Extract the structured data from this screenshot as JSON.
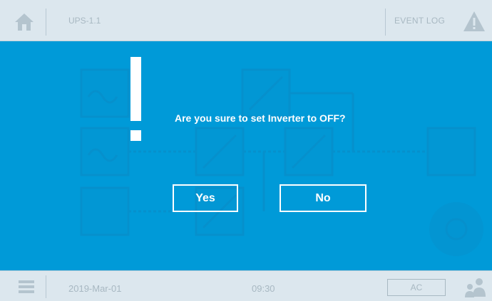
{
  "header": {
    "device_id": "UPS-1.1",
    "event_log_label": "EVENT LOG",
    "icons": [
      "home-icon",
      "warning-icon"
    ]
  },
  "dialog": {
    "message": "Are you sure to set Inverter to OFF?",
    "yes_label": "Yes",
    "no_label": "No",
    "icon": "exclamation-icon"
  },
  "footer": {
    "date": "2019-Mar-01",
    "time": "09:30",
    "mode": "AC",
    "icons": [
      "menu-icon",
      "user-icon"
    ]
  },
  "colors": {
    "background_blue": "#009ad8",
    "bar_gray": "#dce7ee",
    "muted_text": "#a8b8c2",
    "dialog_text": "#ffffff"
  }
}
